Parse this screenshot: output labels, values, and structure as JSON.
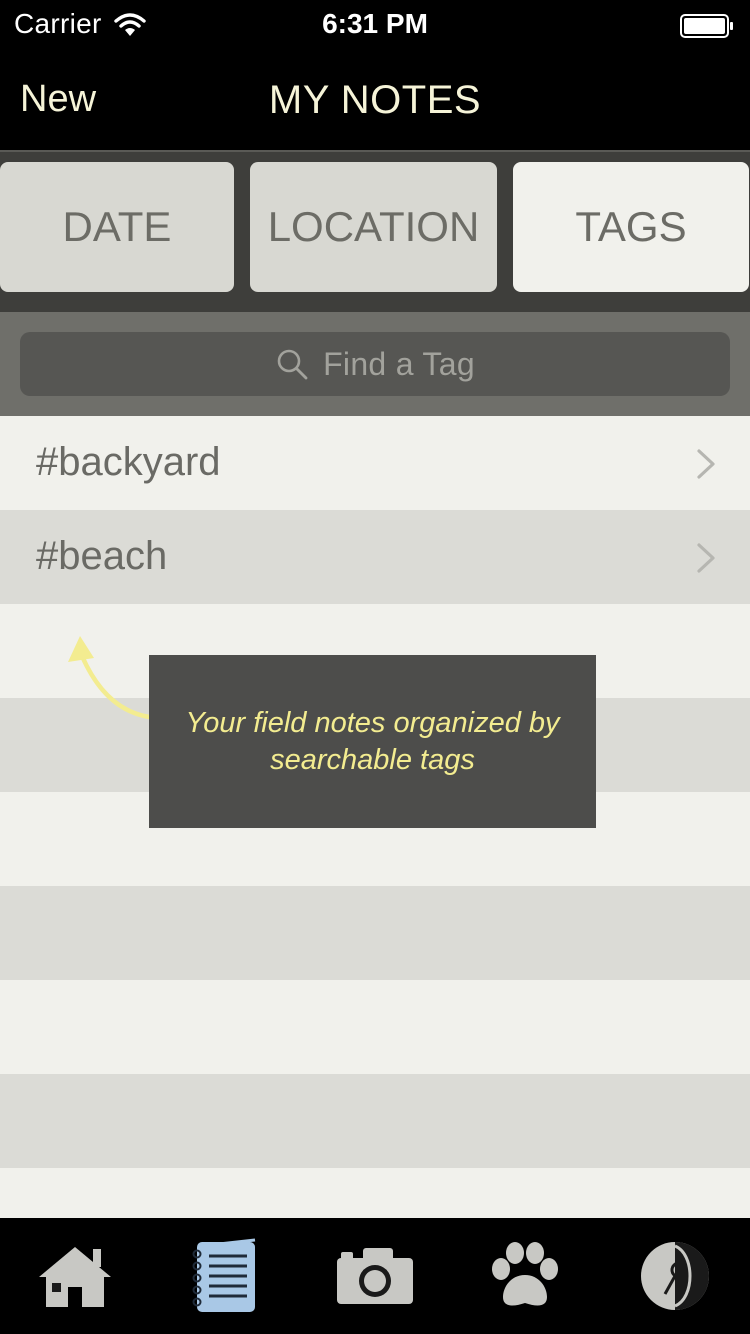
{
  "status_bar": {
    "carrier": "Carrier",
    "time": "6:31 PM"
  },
  "nav": {
    "left_button": "New",
    "title": "MY NOTES"
  },
  "segments": {
    "items": [
      {
        "label": "DATE",
        "active": false
      },
      {
        "label": "LOCATION",
        "active": false
      },
      {
        "label": "TAGS",
        "active": true
      }
    ]
  },
  "search": {
    "placeholder": "Find a Tag"
  },
  "tags": {
    "items": [
      {
        "label": "#backyard"
      },
      {
        "label": "#beach"
      }
    ]
  },
  "coach_mark": {
    "text": "Your field notes organized by searchable tags"
  },
  "tab_bar": {
    "items": [
      {
        "icon": "home-icon",
        "selected": false
      },
      {
        "icon": "notebook-icon",
        "selected": true
      },
      {
        "icon": "camera-icon",
        "selected": false
      },
      {
        "icon": "paw-icon",
        "selected": false
      },
      {
        "icon": "compass-icon",
        "selected": false
      }
    ]
  },
  "colors": {
    "accent_yellow": "#f3ec90",
    "notebook_blue": "#a9c8e6"
  }
}
